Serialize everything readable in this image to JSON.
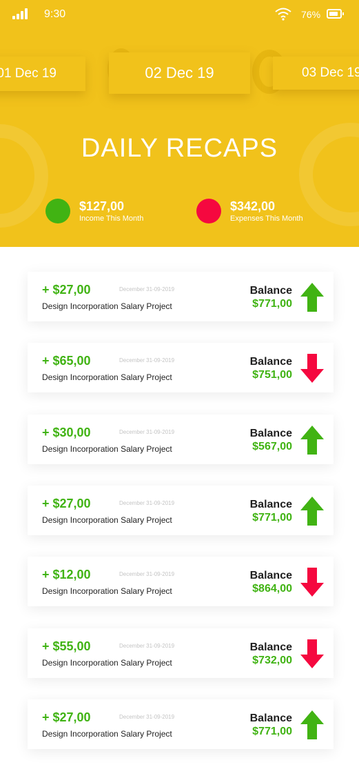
{
  "status_bar": {
    "time": "9:30",
    "battery": "76%"
  },
  "dates": {
    "previous": "01 Dec 19",
    "current": "02 Dec 19",
    "next": "03 Dec 19"
  },
  "title": "DAILY RECAPS",
  "summary": {
    "income": {
      "amount": "$127,00",
      "label": "Income This Month"
    },
    "expenses": {
      "amount": "$342,00",
      "label": "Expenses This Month"
    }
  },
  "colors": {
    "brand": "#f1c21b",
    "positive": "#41b313",
    "negative": "#f5083f"
  },
  "transactions": [
    {
      "amount": "+ $27,00",
      "date": "December 31-09-2019",
      "description": "Design Incorporation Salary Project",
      "balance_label": "Balance",
      "balance": "$771,00",
      "direction": "up"
    },
    {
      "amount": "+ $65,00",
      "date": "December 31-09-2019",
      "description": "Design Incorporation Salary Project",
      "balance_label": "Balance",
      "balance": "$751,00",
      "direction": "down"
    },
    {
      "amount": "+ $30,00",
      "date": "December 31-09-2019",
      "description": "Design Incorporation Salary Project",
      "balance_label": "Balance",
      "balance": "$567,00",
      "direction": "up"
    },
    {
      "amount": "+ $27,00",
      "date": "December 31-09-2019",
      "description": "Design Incorporation Salary Project",
      "balance_label": "Balance",
      "balance": "$771,00",
      "direction": "up"
    },
    {
      "amount": "+ $12,00",
      "date": "December 31-09-2019",
      "description": "Design Incorporation Salary Project",
      "balance_label": "Balance",
      "balance": "$864,00",
      "direction": "down"
    },
    {
      "amount": "+ $55,00",
      "date": "December 31-09-2019",
      "description": "Design Incorporation Salary Project",
      "balance_label": "Balance",
      "balance": "$732,00",
      "direction": "down"
    },
    {
      "amount": "+ $27,00",
      "date": "December 31-09-2019",
      "description": "Design Incorporation Salary Project",
      "balance_label": "Balance",
      "balance": "$771,00",
      "direction": "up"
    }
  ]
}
